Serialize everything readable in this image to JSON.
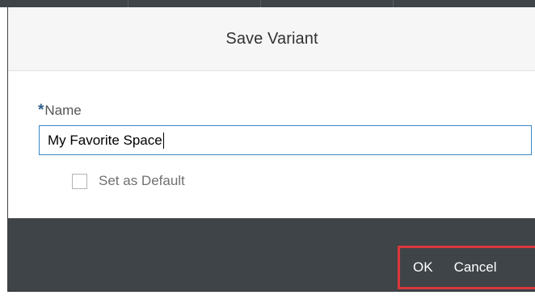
{
  "dialog": {
    "title": "Save Variant",
    "name_field": {
      "required_marker": "*",
      "label": "Name",
      "value": "My Favorite Space"
    },
    "default_checkbox": {
      "label": "Set as Default",
      "checked": false
    },
    "footer": {
      "ok_label": "OK",
      "cancel_label": "Cancel"
    }
  },
  "colors": {
    "footer_bg": "#3f4448",
    "input_border": "#3a88c8",
    "required_marker": "#2f5f8a",
    "highlight_border": "#d9383b"
  }
}
